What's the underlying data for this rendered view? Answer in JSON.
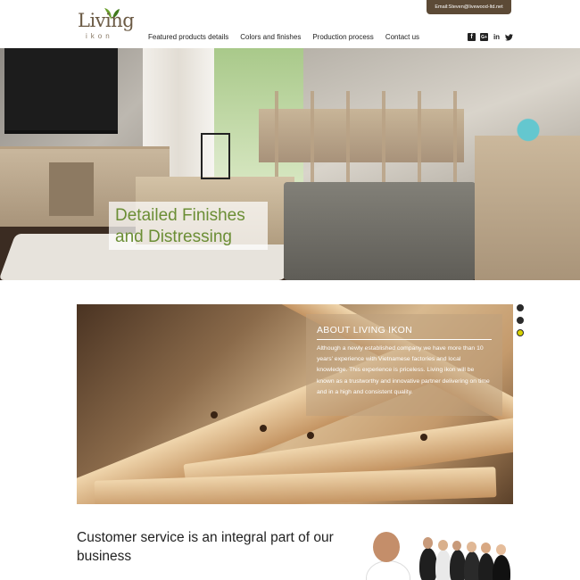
{
  "header": {
    "logo_text": "Living",
    "logo_sub": "ikon",
    "email": "Email:Steven@livewood-ltd.net",
    "nav": [
      {
        "label": "Featured products details"
      },
      {
        "label": "Colors and finishes"
      },
      {
        "label": "Production process"
      },
      {
        "label": "Contact us"
      }
    ],
    "socials": [
      {
        "icon": "facebook-icon",
        "glyph": "f"
      },
      {
        "icon": "google-plus-icon",
        "glyph": "G+"
      },
      {
        "icon": "linkedin-icon",
        "glyph": "in"
      },
      {
        "icon": "twitter-icon",
        "glyph": "🐦"
      }
    ]
  },
  "hero": {
    "caption_line1": "Detailed Finishes",
    "caption_line2": "and Distressing"
  },
  "about": {
    "title": "ABOUT LIVING IKON",
    "text": "Although a newly established company we have more than 10 years' experience with Vietnamese factories and local knowledge. This experience is priceless. Living ikon will be known as a trustworthy and innovative partner delivering on time and in a high and consistent quality."
  },
  "slider": {
    "dots": 3,
    "active_index": 2
  },
  "service": {
    "title": "Customer service is an integral part of our business"
  },
  "colors": {
    "brand_brown": "#5c4a36",
    "caption_green": "#6b8e35",
    "active_dot": "#d7d200"
  }
}
